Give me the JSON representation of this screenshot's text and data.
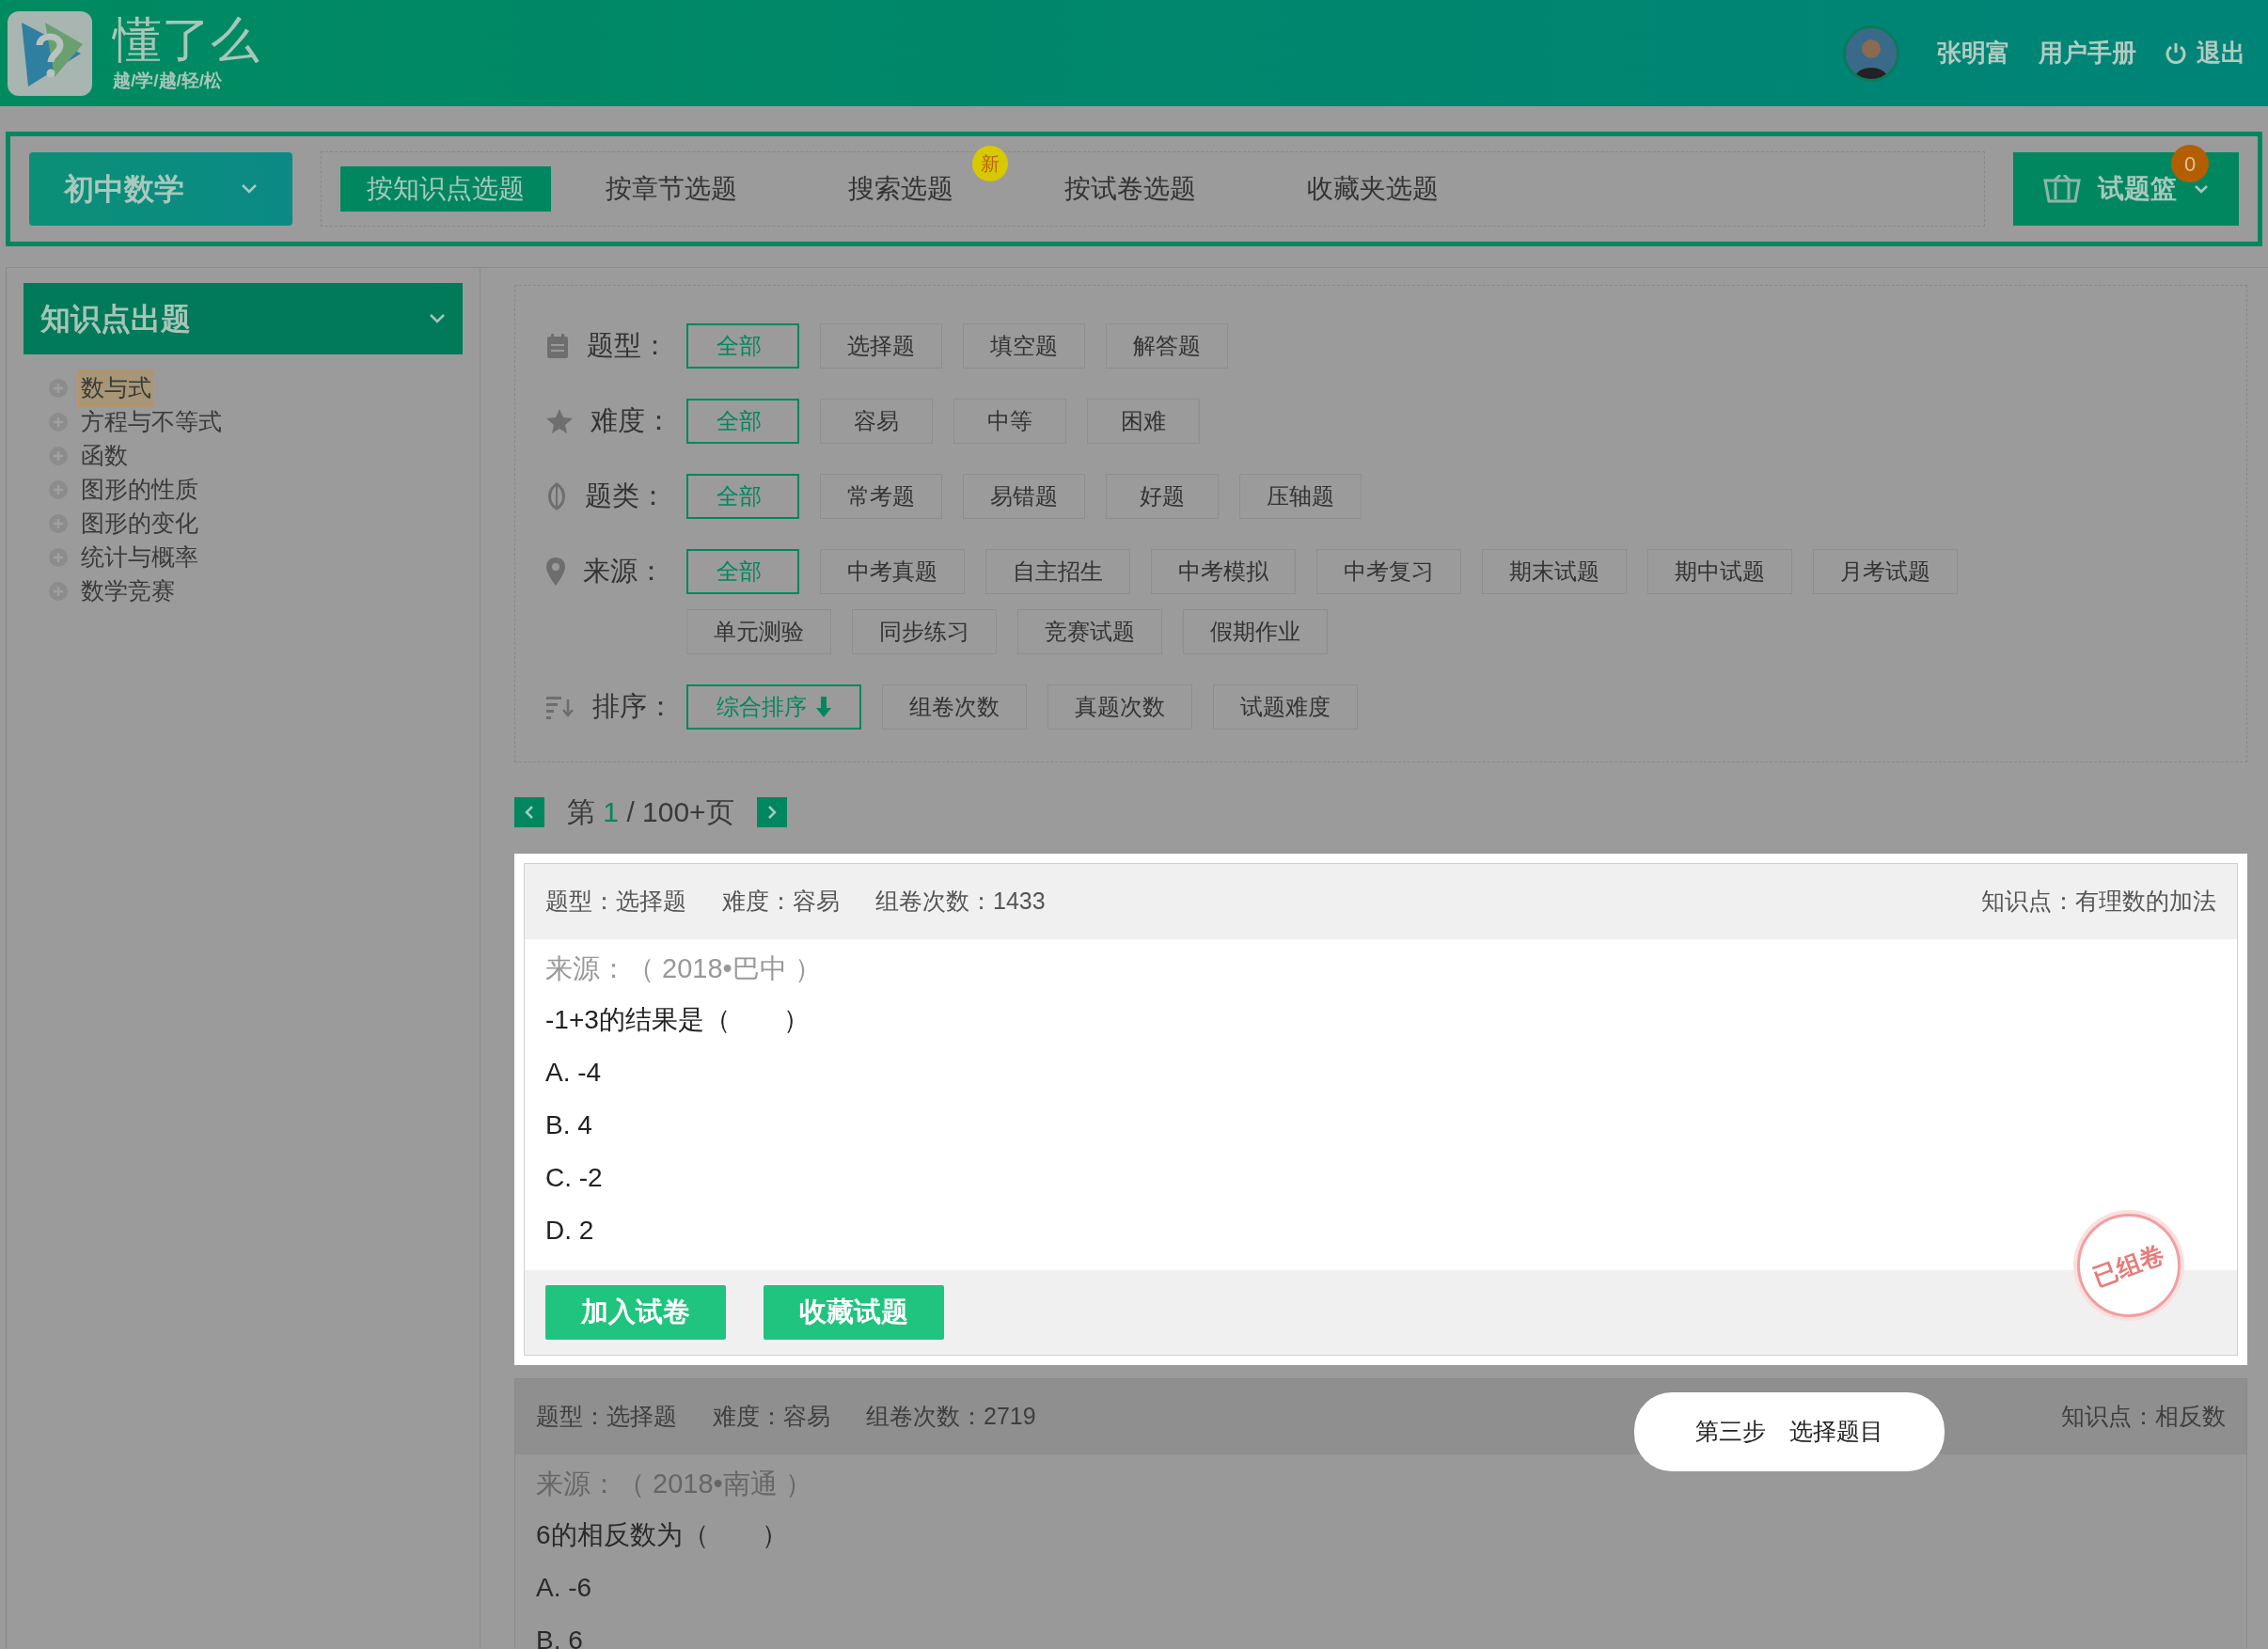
{
  "header": {
    "logo_title": "懂了么",
    "logo_slogan": "越/学/越/轻/松",
    "user_name": "张明富",
    "manual_link": "用户手册",
    "logout": "退出"
  },
  "nav": {
    "subject": "初中数学",
    "tabs": [
      {
        "label": "按知识点选题",
        "selected": true
      },
      {
        "label": "按章节选题",
        "selected": false
      },
      {
        "label": "搜索选题",
        "selected": false,
        "badge": "新"
      },
      {
        "label": "按试卷选题",
        "selected": false
      },
      {
        "label": "收藏夹选题",
        "selected": false
      }
    ],
    "basket": {
      "label": "试题篮",
      "count": "0"
    }
  },
  "sidebar": {
    "title": "知识点出题",
    "items": [
      {
        "label": "数与式",
        "selected": true
      },
      {
        "label": "方程与不等式",
        "selected": false
      },
      {
        "label": "函数",
        "selected": false
      },
      {
        "label": "图形的性质",
        "selected": false
      },
      {
        "label": "图形的变化",
        "selected": false
      },
      {
        "label": "统计与概率",
        "selected": false
      },
      {
        "label": "数学竞赛",
        "selected": false
      }
    ]
  },
  "filters": [
    {
      "kind": "type",
      "label": "题型：",
      "options": [
        {
          "label": "全部",
          "selected": true
        },
        {
          "label": "选择题",
          "selected": false
        },
        {
          "label": "填空题",
          "selected": false
        },
        {
          "label": "解答题",
          "selected": false
        }
      ]
    },
    {
      "kind": "difficulty",
      "label": "难度：",
      "options": [
        {
          "label": "全部",
          "selected": true
        },
        {
          "label": "容易",
          "selected": false
        },
        {
          "label": "中等",
          "selected": false
        },
        {
          "label": "困难",
          "selected": false
        }
      ]
    },
    {
      "kind": "category",
      "label": "题类：",
      "options": [
        {
          "label": "全部",
          "selected": true
        },
        {
          "label": "常考题",
          "selected": false
        },
        {
          "label": "易错题",
          "selected": false
        },
        {
          "label": "好题",
          "selected": false
        },
        {
          "label": "压轴题",
          "selected": false
        }
      ]
    },
    {
      "kind": "source",
      "label": "来源：",
      "options": [
        {
          "label": "全部",
          "selected": true
        },
        {
          "label": "中考真题",
          "selected": false
        },
        {
          "label": "自主招生",
          "selected": false
        },
        {
          "label": "中考模拟",
          "selected": false
        },
        {
          "label": "中考复习",
          "selected": false
        },
        {
          "label": "期末试题",
          "selected": false
        },
        {
          "label": "期中试题",
          "selected": false
        },
        {
          "label": "月考试题",
          "selected": false
        },
        {
          "label": "单元测验",
          "selected": false
        },
        {
          "label": "同步练习",
          "selected": false
        },
        {
          "label": "竞赛试题",
          "selected": false
        },
        {
          "label": "假期作业",
          "selected": false
        }
      ]
    },
    {
      "kind": "sort",
      "label": "排序：",
      "options": [
        {
          "label": "综合排序",
          "selected": true,
          "descending": true
        },
        {
          "label": "组卷次数",
          "selected": false
        },
        {
          "label": "真题次数",
          "selected": false
        },
        {
          "label": "试题难度",
          "selected": false
        }
      ]
    }
  ],
  "pagination": {
    "prefix": "第",
    "current": "1",
    "suffix": "/ 100+页"
  },
  "questions": [
    {
      "highlighted": true,
      "type": "题型：选择题",
      "difficulty": "难度：容易",
      "uses": "组卷次数：1433",
      "knowledge": "知识点：有理数的加法",
      "source": "来源：（ 2018•巴中 ）",
      "stem": "-1+3的结果是（　　）",
      "choices": [
        "A. -4",
        "B. 4",
        "C. -2",
        "D. 2"
      ],
      "stamp": "已组卷",
      "buttons": [
        "加入试卷",
        "收藏试题"
      ]
    },
    {
      "highlighted": false,
      "type": "题型：选择题",
      "difficulty": "难度：容易",
      "uses": "组卷次数：2719",
      "knowledge": "知识点：相反数",
      "source": "来源：（ 2018•南通 ）",
      "stem": "6的相反数为（　　）",
      "choices": [
        "A. -6",
        "B. 6"
      ],
      "callout": "第三步　选择题目"
    }
  ]
}
